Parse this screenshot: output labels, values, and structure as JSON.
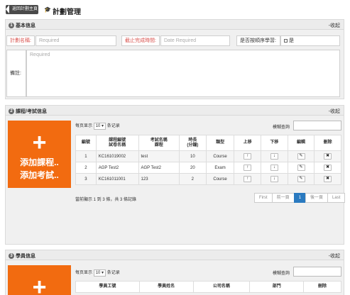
{
  "header": {
    "back_label": "返回計劃主頁",
    "title_icon": "graduation-cap-icon",
    "title": "計劃管理"
  },
  "basic": {
    "num": "1",
    "title": "基本信息",
    "collapse": "-收起",
    "plan_name_label": "計劃名稱:",
    "plan_name_placeholder": "Required",
    "deadline_label": "截止完成時間:",
    "deadline_placeholder": "Date Required",
    "sequential_label": "是否按順序學習:",
    "sequential_option": "是",
    "remark_label": "備註:",
    "remark_placeholder": "Required"
  },
  "course": {
    "num": "2",
    "title": "課程/考試信息",
    "collapse": "-收起",
    "add_plus": "+",
    "add_line1": "添加課程..",
    "add_line2": "添加考試..",
    "page_size_prefix": "每页显示",
    "page_size": "10",
    "page_size_suffix": "条记录",
    "search_label": "模糊查詢",
    "columns": [
      "編號",
      "課程編號\n試卷名稱",
      "考試名稱\n課程",
      "時長\n(分鐘)",
      "類型",
      "上移",
      "下移",
      "編輯",
      "刪除"
    ],
    "rows": [
      {
        "no": "1",
        "code": "KC161019002",
        "name": "test",
        "duration": "10",
        "type": "Course"
      },
      {
        "no": "2",
        "code": "AGP Test2",
        "name": "AGP Test2",
        "duration": "20",
        "type": "Exam"
      },
      {
        "no": "3",
        "code": "KC161011001",
        "name": "123",
        "duration": "2",
        "type": "Course"
      }
    ],
    "summary": "當前顯示 1 到 3 條，共 3 條記錄",
    "pager": [
      "First",
      "前一頁",
      "1",
      "後一頁",
      "Last"
    ],
    "active_page": "1"
  },
  "students": {
    "num": "3",
    "title": "學員信息",
    "collapse": "-收起",
    "add_plus": "+",
    "page_size_prefix": "每页显示",
    "page_size": "10",
    "page_size_suffix": "条记录",
    "search_label": "模糊查詢",
    "columns": [
      "學員工號",
      "學員姓名",
      "公司名稱",
      "部門",
      "刪除"
    ]
  }
}
